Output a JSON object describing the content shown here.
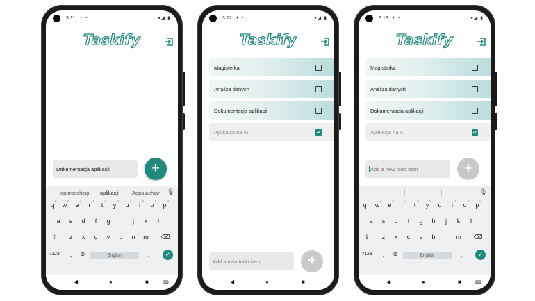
{
  "app": {
    "title": "Taskify"
  },
  "colors": {
    "accent": "#1f8a7d",
    "fab_disabled": "#c9c9c9",
    "frame": "#1b1b1b"
  },
  "phones": [
    {
      "status": {
        "time": "3:11",
        "icons": "◐ ▪",
        "right": "▾◢ ▮"
      },
      "input": {
        "value_prefix": "Dokumentacja ",
        "value_suffix": "aplikacji"
      },
      "fab_label": "+",
      "keyboard": {
        "suggestions": [
          "approaching",
          "aplikacji",
          "Appalachian"
        ],
        "row1": [
          "q",
          "w",
          "e",
          "r",
          "t",
          "y",
          "u",
          "i",
          "o",
          "p"
        ],
        "row1_hints": [
          "1",
          "2",
          "3",
          "4",
          "5",
          "6",
          "7",
          "8",
          "9",
          "0"
        ],
        "row2": [
          "a",
          "s",
          "d",
          "f",
          "g",
          "h",
          "j",
          "k",
          "l"
        ],
        "row3": [
          "z",
          "x",
          "c",
          "v",
          "b",
          "n",
          "m"
        ],
        "sym": "?123",
        "comma": ",",
        "space": "English",
        "period": "."
      }
    },
    {
      "status": {
        "time": "3:12",
        "icons": "◐ ▪",
        "right": "▾◢ ▮"
      },
      "todos": [
        {
          "label": "Magisterka",
          "done": false
        },
        {
          "label": "Analiza danych",
          "done": false
        },
        {
          "label": "Dokumentacja aplikacji",
          "done": false
        },
        {
          "label": "Aplikacja na AI",
          "done": true
        }
      ],
      "input": {
        "placeholder": "Add a new todo item"
      },
      "fab_label": "+"
    },
    {
      "status": {
        "time": "3:13",
        "icons": "◐ ▪",
        "right": "▾◢ ▮"
      },
      "todos": [
        {
          "label": "Magisterka",
          "done": false
        },
        {
          "label": "Analiza danych",
          "done": false
        },
        {
          "label": "Dokumentacja aplikacji",
          "done": false
        },
        {
          "label": "Aplikacja na AI",
          "done": true
        }
      ],
      "input": {
        "placeholder": "Add a new todo item"
      },
      "fab_label": "+",
      "keyboard": {
        "row1": [
          "q",
          "w",
          "e",
          "r",
          "t",
          "y",
          "u",
          "i",
          "o",
          "p"
        ],
        "row1_hints": [
          "1",
          "2",
          "3",
          "4",
          "5",
          "6",
          "7",
          "8",
          "9",
          "0"
        ],
        "row2": [
          "a",
          "s",
          "d",
          "f",
          "g",
          "h",
          "j",
          "k",
          "l"
        ],
        "row3": [
          "z",
          "x",
          "c",
          "v",
          "b",
          "n",
          "m"
        ],
        "sym": "?123",
        "comma": ",",
        "space": "English",
        "period": "."
      }
    }
  ],
  "nav": {
    "back": "◀",
    "home": "●",
    "recents": "■"
  }
}
